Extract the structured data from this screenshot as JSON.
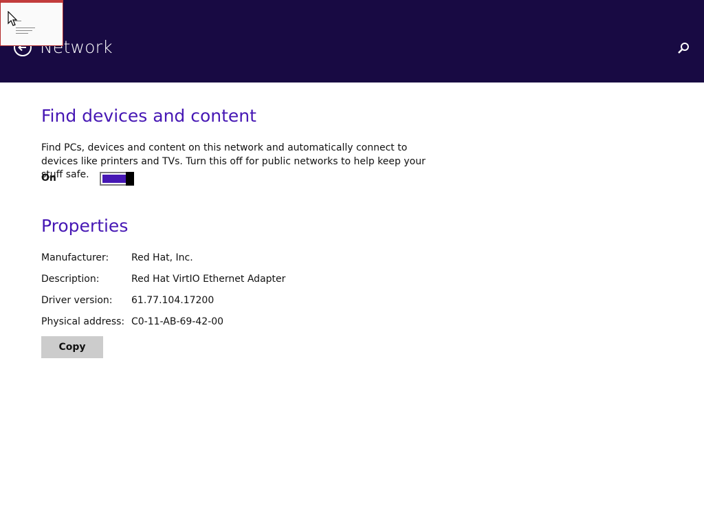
{
  "header": {
    "title": "Network",
    "back_icon": "back-arrow-icon",
    "search_icon": "search-icon",
    "background": "#180a43"
  },
  "find_devices": {
    "title": "Find devices and content",
    "description": "Find PCs, devices and content on this network and automatically connect to devices like printers and TVs. Turn this off for public networks to help keep your stuff safe.",
    "toggle_label": "On",
    "toggle_on": true,
    "accent": "#4617b4"
  },
  "properties": {
    "title": "Properties",
    "rows": [
      {
        "key": "Manufacturer:",
        "value": "Red Hat, Inc."
      },
      {
        "key": "Description:",
        "value": "Red Hat VirtIO Ethernet Adapter"
      },
      {
        "key": "Driver version:",
        "value": "61.77.104.17200"
      },
      {
        "key": "Physical address:",
        "value": "C0-11-AB-69-42-00"
      }
    ],
    "copy_label": "Copy"
  }
}
